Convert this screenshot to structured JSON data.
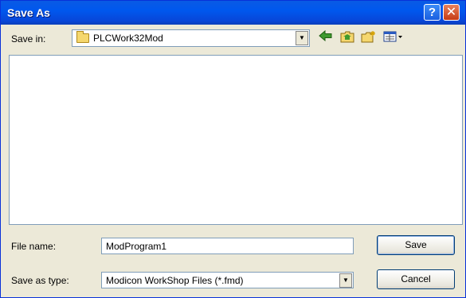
{
  "window": {
    "title": "Save As"
  },
  "titlebar": {
    "help_glyph": "?",
    "close_glyph": "✕"
  },
  "toolbar": {
    "save_in_label": "Save in:",
    "location": "PLCWork32Mod",
    "icons": [
      "back-arrow-icon",
      "up-folder-icon",
      "new-folder-icon",
      "view-menu-icon"
    ]
  },
  "form": {
    "file_name_label": "File name:",
    "file_name_value": "ModProgram1",
    "save_type_label": "Save as type:",
    "save_type_value": "Modicon WorkShop Files (*.fmd)"
  },
  "buttons": {
    "save": "Save",
    "cancel": "Cancel"
  }
}
